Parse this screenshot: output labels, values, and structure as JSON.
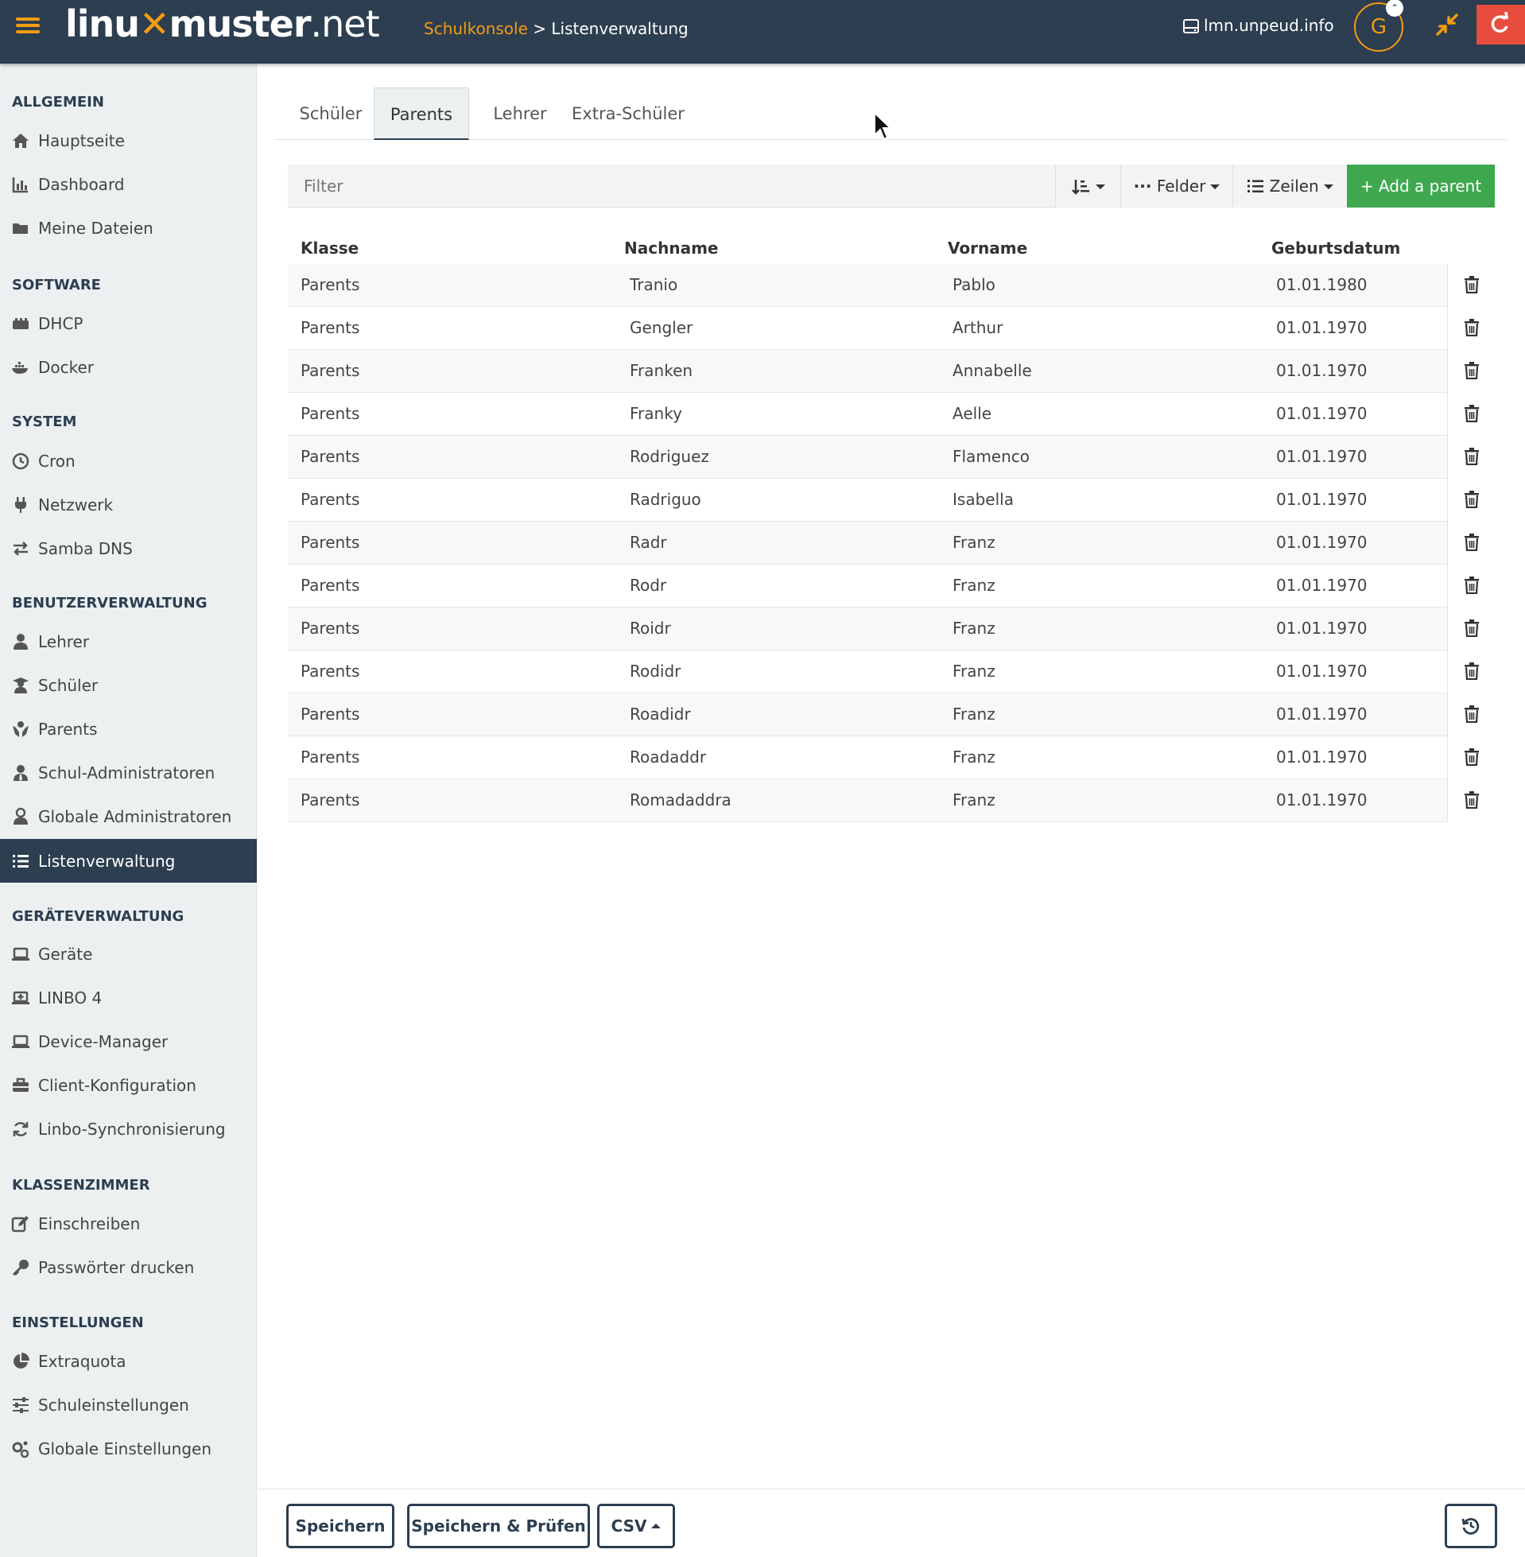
{
  "header": {
    "logo_left": "linu",
    "logo_right": "muster",
    "logo_net": ".net",
    "breadcrumb_root": "Schulkonsole",
    "breadcrumb_sep": ">",
    "breadcrumb_current": "Listenverwaltung",
    "host": "lmn.unpeud.info",
    "avatar_initial": "G",
    "accent": "#f39c12",
    "bar_color": "#2c3e50"
  },
  "sidebar": {
    "sections": [
      {
        "heading": "ALLGEMEIN",
        "items": [
          {
            "label": "Hauptseite",
            "icon": "home-icon"
          },
          {
            "label": "Dashboard",
            "icon": "chart-icon"
          },
          {
            "label": "Meine Dateien",
            "icon": "folder-icon"
          }
        ]
      },
      {
        "heading": "SOFTWARE",
        "items": [
          {
            "label": "DHCP",
            "icon": "network-icon"
          },
          {
            "label": "Docker",
            "icon": "docker-icon"
          }
        ]
      },
      {
        "heading": "SYSTEM",
        "items": [
          {
            "label": "Cron",
            "icon": "clock-icon"
          },
          {
            "label": "Netzwerk",
            "icon": "plug-icon"
          },
          {
            "label": "Samba DNS",
            "icon": "exchange-icon"
          }
        ]
      },
      {
        "heading": "BENUTZERVERWALTUNG",
        "items": [
          {
            "label": "Lehrer",
            "icon": "user-icon"
          },
          {
            "label": "Schüler",
            "icon": "student-icon"
          },
          {
            "label": "Parents",
            "icon": "hands-icon"
          },
          {
            "label": "Schul-Administratoren",
            "icon": "user-tie-icon"
          },
          {
            "label": "Globale Administratoren",
            "icon": "user-shield-icon"
          },
          {
            "label": "Listenverwaltung",
            "icon": "list-icon"
          }
        ]
      },
      {
        "heading": "GERÄTEVERWALTUNG",
        "items": [
          {
            "label": "Geräte",
            "icon": "laptop-icon"
          },
          {
            "label": "LINBO 4",
            "icon": "laptop-plus-icon"
          },
          {
            "label": "Device-Manager",
            "icon": "laptop-icon"
          },
          {
            "label": "Client-Konfiguration",
            "icon": "toolbox-icon"
          },
          {
            "label": "Linbo-Synchronisierung",
            "icon": "sync-icon"
          }
        ]
      },
      {
        "heading": "KLASSENZIMMER",
        "items": [
          {
            "label": "Einschreiben",
            "icon": "edit-icon"
          },
          {
            "label": "Passwörter drucken",
            "icon": "key-icon"
          }
        ]
      },
      {
        "heading": "EINSTELLUNGEN",
        "items": [
          {
            "label": "Extraquota",
            "icon": "pie-icon"
          },
          {
            "label": "Schuleinstellungen",
            "icon": "sliders-icon"
          },
          {
            "label": "Globale Einstellungen",
            "icon": "cogs-icon"
          }
        ]
      }
    ]
  },
  "tabs": [
    {
      "label": "Schüler"
    },
    {
      "label": "Parents"
    },
    {
      "label": "Lehrer"
    },
    {
      "label": "Extra-Schüler"
    }
  ],
  "toolbar": {
    "filter_placeholder": "Filter",
    "fields_label": "Felder",
    "rows_label": "Zeilen",
    "add_label": "+ Add a parent"
  },
  "table": {
    "columns": [
      "Klasse",
      "Nachname",
      "Vorname",
      "Geburtsdatum"
    ],
    "rows": [
      [
        "Parents",
        "Tranio",
        "Pablo",
        "01.01.1980"
      ],
      [
        "Parents",
        "Gengler",
        "Arthur",
        "01.01.1970"
      ],
      [
        "Parents",
        "Franken",
        "Annabelle",
        "01.01.1970"
      ],
      [
        "Parents",
        "Franky",
        "Aelle",
        "01.01.1970"
      ],
      [
        "Parents",
        "Rodriguez",
        "Flamenco",
        "01.01.1970"
      ],
      [
        "Parents",
        "Radriguo",
        "Isabella",
        "01.01.1970"
      ],
      [
        "Parents",
        "Radr",
        "Franz",
        "01.01.1970"
      ],
      [
        "Parents",
        "Rodr",
        "Franz",
        "01.01.1970"
      ],
      [
        "Parents",
        "Roidr",
        "Franz",
        "01.01.1970"
      ],
      [
        "Parents",
        "Rodidr",
        "Franz",
        "01.01.1970"
      ],
      [
        "Parents",
        "Roadidr",
        "Franz",
        "01.01.1970"
      ],
      [
        "Parents",
        "Roadaddr",
        "Franz",
        "01.01.1970"
      ],
      [
        "Parents",
        "Romadaddra",
        "Franz",
        "01.01.1970"
      ]
    ]
  },
  "footer": {
    "save_label": "Speichern",
    "save_check_label": "Speichern & Prüfen",
    "csv_label": "CSV"
  }
}
